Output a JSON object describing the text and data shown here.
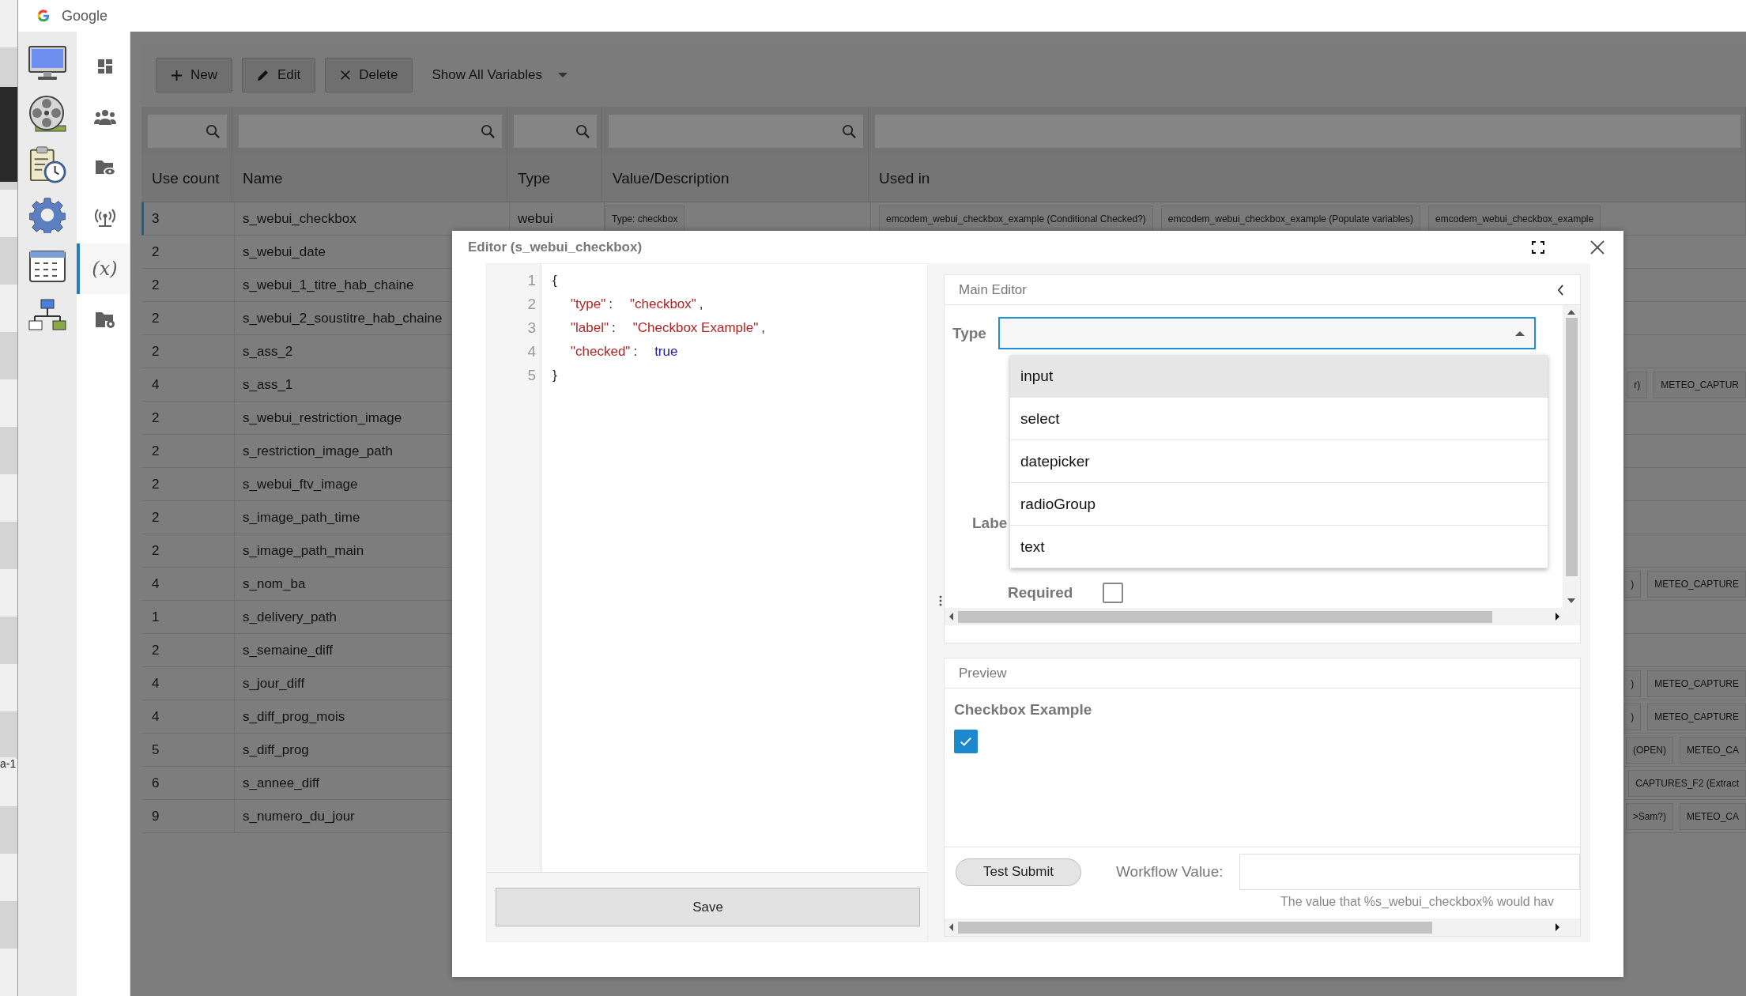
{
  "browser_tab": {
    "title": "Google"
  },
  "background_fragment": "a-1",
  "app_rail": [
    {
      "kind": "monitor"
    },
    {
      "kind": "film-reel"
    },
    {
      "kind": "clipboard-clock"
    },
    {
      "kind": "gear"
    },
    {
      "kind": "calendar"
    },
    {
      "kind": "network"
    }
  ],
  "nav": [
    {
      "kind": "dashboard",
      "selected": false
    },
    {
      "kind": "users",
      "selected": false
    },
    {
      "kind": "folder-eye",
      "selected": false
    },
    {
      "kind": "antenna",
      "selected": false
    },
    {
      "kind": "variable",
      "label": "(x)",
      "selected": true
    },
    {
      "kind": "folder-gear",
      "selected": false
    }
  ],
  "toolbar": {
    "buttons": [
      {
        "kind": "add",
        "label": "New"
      },
      {
        "kind": "edit",
        "label": "Edit"
      },
      {
        "kind": "delete",
        "label": "Delete"
      }
    ],
    "filter": {
      "value": "Show All Variables"
    }
  },
  "table": {
    "columns": [
      "Use count",
      "Name",
      "Type",
      "Value/Description",
      "Used in"
    ],
    "rows": [
      {
        "use_count": "3",
        "name": "s_webui_checkbox",
        "type": "webui",
        "value": "Type: checkbox",
        "used_in": [
          "emcodem_webui_checkbox_example (Conditional Checked?)",
          "emcodem_webui_checkbox_example (Populate variables)",
          "emcodem_webui_checkbox_example"
        ],
        "selected": true
      },
      {
        "use_count": "2",
        "name": "s_webui_date",
        "selected": false
      },
      {
        "use_count": "2",
        "name": "s_webui_1_titre_hab_chaine",
        "selected": false
      },
      {
        "use_count": "2",
        "name": "s_webui_2_soustitre_hab_chaine",
        "selected": false
      },
      {
        "use_count": "2",
        "name": "s_ass_2",
        "selected": false
      },
      {
        "use_count": "4",
        "name": "s_ass_1",
        "used_in": [
          "r)",
          "METEO_CAPTUR"
        ],
        "selected": false
      },
      {
        "use_count": "2",
        "name": "s_webui_restriction_image",
        "selected": false
      },
      {
        "use_count": "2",
        "name": "s_restriction_image_path",
        "selected": false
      },
      {
        "use_count": "2",
        "name": "s_webui_ftv_image",
        "selected": false
      },
      {
        "use_count": "2",
        "name": "s_image_path_time",
        "selected": false
      },
      {
        "use_count": "2",
        "name": "s_image_path_main",
        "selected": false
      },
      {
        "use_count": "4",
        "name": "s_nom_ba",
        "used_in": [
          ")",
          "METEO_CAPTURE"
        ],
        "selected": false
      },
      {
        "use_count": "1",
        "name": "s_delivery_path",
        "selected": false
      },
      {
        "use_count": "2",
        "name": "s_semaine_diff",
        "selected": false
      },
      {
        "use_count": "4",
        "name": "s_jour_diff",
        "used_in": [
          ")",
          "METEO_CAPTURE"
        ],
        "selected": false
      },
      {
        "use_count": "4",
        "name": "s_diff_prog_mois",
        "used_in": [
          ")",
          "METEO_CAPTURE"
        ],
        "selected": false
      },
      {
        "use_count": "5",
        "name": "s_diff_prog",
        "used_in": [
          "(OPEN)",
          "METEO_CA"
        ],
        "selected": false
      },
      {
        "use_count": "6",
        "name": "s_annee_diff",
        "used_in": [
          "CAPTURES_F2 (Extract"
        ],
        "selected": false
      },
      {
        "use_count": "9",
        "name": "s_numero_du_jour",
        "used_in": [
          ">Sam?)",
          "METEO_CA"
        ],
        "selected": false
      }
    ]
  },
  "editor": {
    "title": "Editor (s_webui_checkbox)",
    "code_lines": [
      {
        "number": "1",
        "tokens": [
          {
            "kind": "punct",
            "text": "{"
          }
        ]
      },
      {
        "number": "2",
        "tokens": [
          {
            "kind": "key",
            "text": "\"type\""
          },
          {
            "kind": "punct",
            "text": ":"
          },
          {
            "kind": "string",
            "text": "\"checkbox\""
          },
          {
            "kind": "punct",
            "text": ","
          }
        ]
      },
      {
        "number": "3",
        "tokens": [
          {
            "kind": "key",
            "text": "\"label\""
          },
          {
            "kind": "punct",
            "text": ":"
          },
          {
            "kind": "string",
            "text": "\"Checkbox Example\""
          },
          {
            "kind": "punct",
            "text": ","
          }
        ]
      },
      {
        "number": "4",
        "tokens": [
          {
            "kind": "key",
            "text": "\"checked\""
          },
          {
            "kind": "punct",
            "text": ":"
          },
          {
            "kind": "literal",
            "text": "true"
          }
        ]
      },
      {
        "number": "5",
        "tokens": [
          {
            "kind": "punct",
            "text": "}"
          }
        ]
      }
    ],
    "save_label": "Save",
    "main_editor": {
      "title": "Main Editor",
      "type_label": "Type",
      "dropdown_expanded": true,
      "options": [
        {
          "label": "input",
          "selected": true
        },
        {
          "label": "select",
          "selected": false
        },
        {
          "label": "datepicker",
          "selected": false
        },
        {
          "label": "radioGroup",
          "selected": false
        },
        {
          "label": "text",
          "selected": false
        }
      ],
      "label_field_label": "Labe",
      "required": {
        "label": "Required",
        "checked": false
      }
    },
    "preview": {
      "title": "Preview",
      "checkbox_label": "Checkbox Example",
      "checked": true,
      "test_button": "Test Submit",
      "workflow_label": "Workflow Value:",
      "workflow_hint": "The value that %s_webui_checkbox% would hav"
    }
  }
}
